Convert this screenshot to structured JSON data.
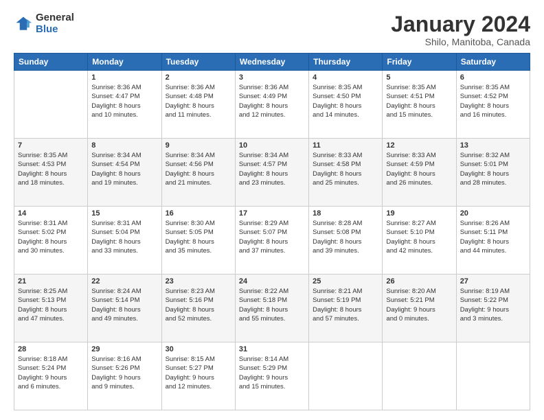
{
  "header": {
    "logo_general": "General",
    "logo_blue": "Blue",
    "month_title": "January 2024",
    "subtitle": "Shilo, Manitoba, Canada"
  },
  "days_of_week": [
    "Sunday",
    "Monday",
    "Tuesday",
    "Wednesday",
    "Thursday",
    "Friday",
    "Saturday"
  ],
  "weeks": [
    [
      {
        "day": "",
        "info": ""
      },
      {
        "day": "1",
        "info": "Sunrise: 8:36 AM\nSunset: 4:47 PM\nDaylight: 8 hours\nand 10 minutes."
      },
      {
        "day": "2",
        "info": "Sunrise: 8:36 AM\nSunset: 4:48 PM\nDaylight: 8 hours\nand 11 minutes."
      },
      {
        "day": "3",
        "info": "Sunrise: 8:36 AM\nSunset: 4:49 PM\nDaylight: 8 hours\nand 12 minutes."
      },
      {
        "day": "4",
        "info": "Sunrise: 8:35 AM\nSunset: 4:50 PM\nDaylight: 8 hours\nand 14 minutes."
      },
      {
        "day": "5",
        "info": "Sunrise: 8:35 AM\nSunset: 4:51 PM\nDaylight: 8 hours\nand 15 minutes."
      },
      {
        "day": "6",
        "info": "Sunrise: 8:35 AM\nSunset: 4:52 PM\nDaylight: 8 hours\nand 16 minutes."
      }
    ],
    [
      {
        "day": "7",
        "info": "Sunrise: 8:35 AM\nSunset: 4:53 PM\nDaylight: 8 hours\nand 18 minutes."
      },
      {
        "day": "8",
        "info": "Sunrise: 8:34 AM\nSunset: 4:54 PM\nDaylight: 8 hours\nand 19 minutes."
      },
      {
        "day": "9",
        "info": "Sunrise: 8:34 AM\nSunset: 4:56 PM\nDaylight: 8 hours\nand 21 minutes."
      },
      {
        "day": "10",
        "info": "Sunrise: 8:34 AM\nSunset: 4:57 PM\nDaylight: 8 hours\nand 23 minutes."
      },
      {
        "day": "11",
        "info": "Sunrise: 8:33 AM\nSunset: 4:58 PM\nDaylight: 8 hours\nand 25 minutes."
      },
      {
        "day": "12",
        "info": "Sunrise: 8:33 AM\nSunset: 4:59 PM\nDaylight: 8 hours\nand 26 minutes."
      },
      {
        "day": "13",
        "info": "Sunrise: 8:32 AM\nSunset: 5:01 PM\nDaylight: 8 hours\nand 28 minutes."
      }
    ],
    [
      {
        "day": "14",
        "info": "Sunrise: 8:31 AM\nSunset: 5:02 PM\nDaylight: 8 hours\nand 30 minutes."
      },
      {
        "day": "15",
        "info": "Sunrise: 8:31 AM\nSunset: 5:04 PM\nDaylight: 8 hours\nand 33 minutes."
      },
      {
        "day": "16",
        "info": "Sunrise: 8:30 AM\nSunset: 5:05 PM\nDaylight: 8 hours\nand 35 minutes."
      },
      {
        "day": "17",
        "info": "Sunrise: 8:29 AM\nSunset: 5:07 PM\nDaylight: 8 hours\nand 37 minutes."
      },
      {
        "day": "18",
        "info": "Sunrise: 8:28 AM\nSunset: 5:08 PM\nDaylight: 8 hours\nand 39 minutes."
      },
      {
        "day": "19",
        "info": "Sunrise: 8:27 AM\nSunset: 5:10 PM\nDaylight: 8 hours\nand 42 minutes."
      },
      {
        "day": "20",
        "info": "Sunrise: 8:26 AM\nSunset: 5:11 PM\nDaylight: 8 hours\nand 44 minutes."
      }
    ],
    [
      {
        "day": "21",
        "info": "Sunrise: 8:25 AM\nSunset: 5:13 PM\nDaylight: 8 hours\nand 47 minutes."
      },
      {
        "day": "22",
        "info": "Sunrise: 8:24 AM\nSunset: 5:14 PM\nDaylight: 8 hours\nand 49 minutes."
      },
      {
        "day": "23",
        "info": "Sunrise: 8:23 AM\nSunset: 5:16 PM\nDaylight: 8 hours\nand 52 minutes."
      },
      {
        "day": "24",
        "info": "Sunrise: 8:22 AM\nSunset: 5:18 PM\nDaylight: 8 hours\nand 55 minutes."
      },
      {
        "day": "25",
        "info": "Sunrise: 8:21 AM\nSunset: 5:19 PM\nDaylight: 8 hours\nand 57 minutes."
      },
      {
        "day": "26",
        "info": "Sunrise: 8:20 AM\nSunset: 5:21 PM\nDaylight: 9 hours\nand 0 minutes."
      },
      {
        "day": "27",
        "info": "Sunrise: 8:19 AM\nSunset: 5:22 PM\nDaylight: 9 hours\nand 3 minutes."
      }
    ],
    [
      {
        "day": "28",
        "info": "Sunrise: 8:18 AM\nSunset: 5:24 PM\nDaylight: 9 hours\nand 6 minutes."
      },
      {
        "day": "29",
        "info": "Sunrise: 8:16 AM\nSunset: 5:26 PM\nDaylight: 9 hours\nand 9 minutes."
      },
      {
        "day": "30",
        "info": "Sunrise: 8:15 AM\nSunset: 5:27 PM\nDaylight: 9 hours\nand 12 minutes."
      },
      {
        "day": "31",
        "info": "Sunrise: 8:14 AM\nSunset: 5:29 PM\nDaylight: 9 hours\nand 15 minutes."
      },
      {
        "day": "",
        "info": ""
      },
      {
        "day": "",
        "info": ""
      },
      {
        "day": "",
        "info": ""
      }
    ]
  ]
}
